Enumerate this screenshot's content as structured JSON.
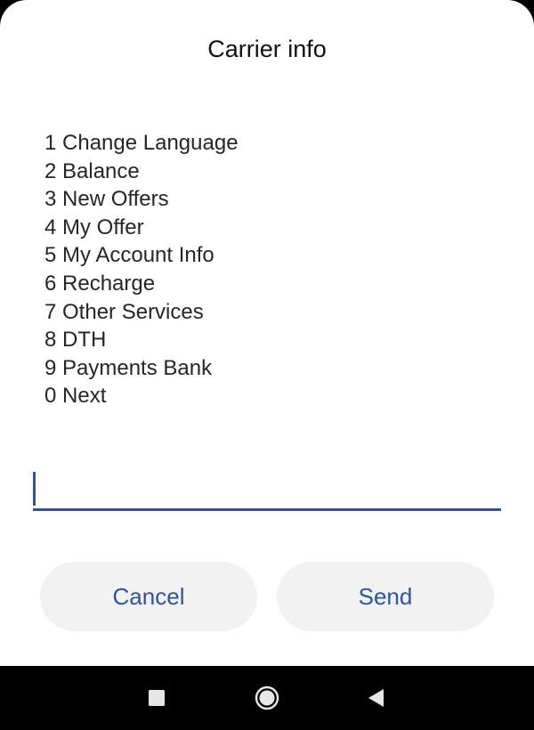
{
  "dialog": {
    "title": "Carrier info",
    "menu_items": [
      "1 Change Language",
      "2 Balance",
      "3 New Offers",
      "4 My Offer",
      "5 My Account Info",
      "6 Recharge",
      "7 Other Services",
      "8 DTH",
      "9 Payments Bank",
      "0 Next"
    ],
    "input": {
      "value": "",
      "placeholder": ""
    },
    "buttons": {
      "cancel": "Cancel",
      "send": "Send"
    }
  },
  "nav_bar": {
    "icons": [
      "recent-apps-icon",
      "home-icon",
      "back-icon"
    ]
  },
  "colors": {
    "accent": "#2b56a8",
    "button_bg": "#f2f2f2",
    "button_text": "#2c55a0",
    "dialog_bg": "#ffffff",
    "nav_bg": "#000000"
  }
}
